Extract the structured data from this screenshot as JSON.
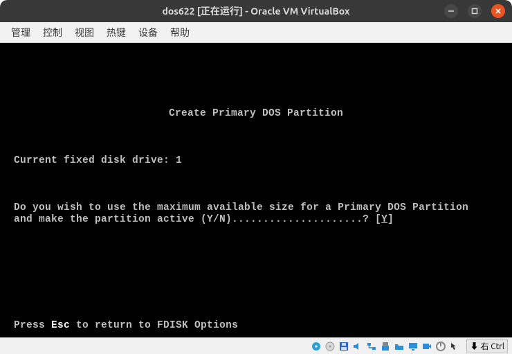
{
  "window": {
    "title": "dos622 [正在运行] - Oracle VM VirtualBox"
  },
  "menu": {
    "items": [
      "管理",
      "控制",
      "视图",
      "热键",
      "设备",
      "帮助"
    ]
  },
  "dos": {
    "heading": "Create Primary DOS Partition",
    "drive_label": "Current fixed disk drive: ",
    "drive_num": "1",
    "question_l1": "Do you wish to use the maximum available size for a Primary DOS Partition",
    "question_l2_pre": "and make the partition active (Y/N).....................? [",
    "input_value": "Y",
    "question_l2_post": "]",
    "footer_pre": "Press ",
    "footer_key": "Esc",
    "footer_post": " to return to FDISK Options"
  },
  "status": {
    "host_key": "右 Ctrl"
  }
}
